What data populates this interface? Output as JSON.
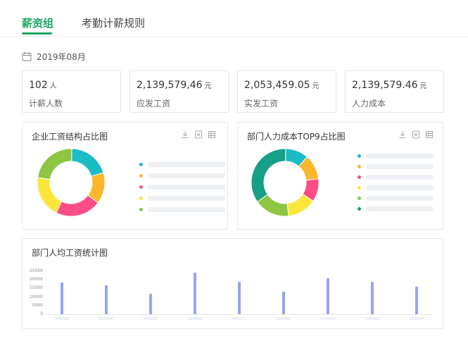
{
  "tabs": [
    {
      "label": "薪资组",
      "active": true
    },
    {
      "label": "考勤计薪规则",
      "active": false
    }
  ],
  "period": "2019年08月",
  "stats": [
    {
      "value": "102",
      "unit": "人",
      "label": "计薪人数"
    },
    {
      "value": "2,139,579,46",
      "unit": "元",
      "label": "应发工资"
    },
    {
      "value": "2,053,459.05",
      "unit": "元",
      "label": "实发工资"
    },
    {
      "value": "2,139,579.46",
      "unit": "元",
      "label": "人力成本"
    }
  ],
  "panels": {
    "salary_structure_title": "企业工资结构占比图",
    "dept_cost_title": "部门人力成本TOP9占比图",
    "dept_avg_title": "部门人均工资统计图"
  },
  "colors": {
    "accent": "#1fa463",
    "bar": "#97a4f4"
  },
  "icons": [
    "download-icon",
    "excel-export-icon",
    "table-view-icon"
  ],
  "chart_data": [
    {
      "type": "pie",
      "title": "企业工资结构占比图",
      "variant": "donut",
      "values": [
        20,
        15,
        22,
        20,
        23
      ],
      "colors": [
        "#1cbcc6",
        "#fbb72c",
        "#fc4d84",
        "#fbe73c",
        "#8ec542"
      ]
    },
    {
      "type": "pie",
      "title": "部门人力成本TOP9占比图",
      "variant": "donut",
      "values": [
        11,
        12,
        11,
        14,
        17,
        35
      ],
      "colors": [
        "#1cbcc6",
        "#fbb72c",
        "#fc4d84",
        "#fbe73c",
        "#8ec542",
        "#16a085"
      ]
    },
    {
      "type": "bar",
      "title": "部门人均工资统计图",
      "yticks": [
        "25000",
        "20000",
        "15000",
        "10000",
        "5000",
        "0"
      ],
      "ylim": [
        0,
        25000
      ],
      "values": [
        18500,
        17000,
        12000,
        24000,
        18800,
        13000,
        21000,
        19000,
        16000
      ]
    }
  ]
}
